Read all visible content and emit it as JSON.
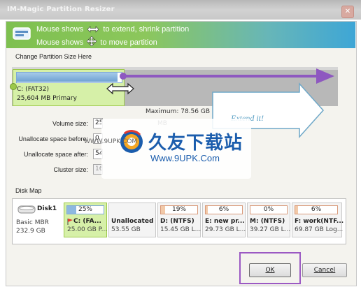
{
  "window": {
    "title": "IM-Magic Partition Resizer",
    "close_glyph": "✕"
  },
  "banner": {
    "tip_extend": "Mouse shows ⇔ to extend, shrink partition",
    "tip_move": "Mouse shows ✥ to move partition",
    "tip_extend_text": "Mouse shows",
    "tip_extend_rest": "to extend, shrink partition",
    "tip_move_text": "Mouse shows",
    "tip_move_rest": "to move partition"
  },
  "resize_panel": {
    "group_label": "Change Partition Size Here",
    "partition_name": "C: (FAT32)",
    "partition_detail": "25,604 MB Primary",
    "maximum_label": "Maximum: 78.56 GB",
    "extend_hint": "Extend it!",
    "fields": {
      "volume_size_label": "Volume size:",
      "volume_size_value": "25",
      "unalloc_before_label": "Unallocate space before:",
      "unalloc_before_value": "0",
      "unalloc_after_label": "Unallocate space after:",
      "unalloc_after_value": "54",
      "cluster_size_label": "Cluster size:",
      "cluster_size_value": "16",
      "unit_mb": "MB"
    }
  },
  "watermark": {
    "cn_text": "久友下载站",
    "url": "Www.9UPK.Com",
    "small_text": "WWW.9UPK.COM"
  },
  "disk_map": {
    "group_label": "Disk Map",
    "disk": {
      "name": "Disk1",
      "type": "Basic MBR",
      "size": "232.9 GB"
    },
    "partitions": [
      {
        "percent": "25%",
        "name": "C: (FA...",
        "info": "25.00 GB P...",
        "selected": true
      },
      {
        "percent": "",
        "name": "Unallocated",
        "info": "53.55 GB",
        "selected": false
      },
      {
        "percent": "19%",
        "name": "D: (NTFS)",
        "info": "15.45 GB L...",
        "selected": false
      },
      {
        "percent": "6%",
        "name": "E: new pr...",
        "info": "29.73 GB L...",
        "selected": false
      },
      {
        "percent": "0%",
        "name": "M: (NTFS)",
        "info": "39.27 GB L...",
        "selected": false
      },
      {
        "percent": "6%",
        "name": "F: work(NTF...",
        "info": "69.87 GB Log...",
        "selected": false
      }
    ]
  },
  "buttons": {
    "ok": "OK",
    "cancel": "Cancel"
  },
  "colors": {
    "accent_green": "#9cc84a",
    "highlight_purple": "#9b59c3",
    "arrow_purple": "#8e58c0"
  }
}
